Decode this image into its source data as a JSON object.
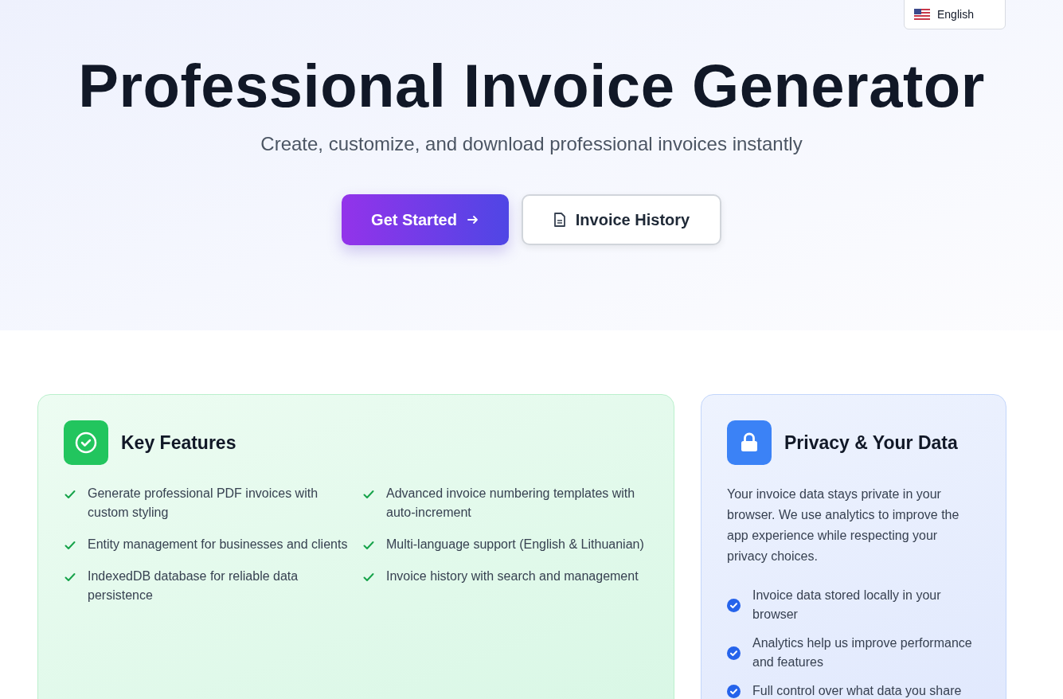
{
  "language_selector": {
    "label": "English"
  },
  "hero": {
    "title": "Professional Invoice Generator",
    "subtitle": "Create, customize, and download professional invoices instantly",
    "buttons": [
      {
        "label": "Get Started",
        "kind": "primary"
      },
      {
        "label": "Invoice History",
        "kind": "secondary"
      }
    ]
  },
  "features_card": {
    "title": "Key Features",
    "items": [
      "Generate professional PDF invoices with custom styling",
      "Advanced invoice numbering templates with auto-increment",
      "Entity management for businesses and clients",
      "Multi-language support (English & Lithuanian)",
      "IndexedDB database for reliable data persistence",
      "Invoice history with search and management"
    ]
  },
  "privacy_card": {
    "title": "Privacy & Your Data",
    "description": "Your invoice data stays private in your browser. We use analytics to improve the app experience while respecting your privacy choices.",
    "items": [
      "Invoice data stored locally in your browser",
      "Analytics help us improve performance and features",
      "Full control over what data you share"
    ]
  }
}
